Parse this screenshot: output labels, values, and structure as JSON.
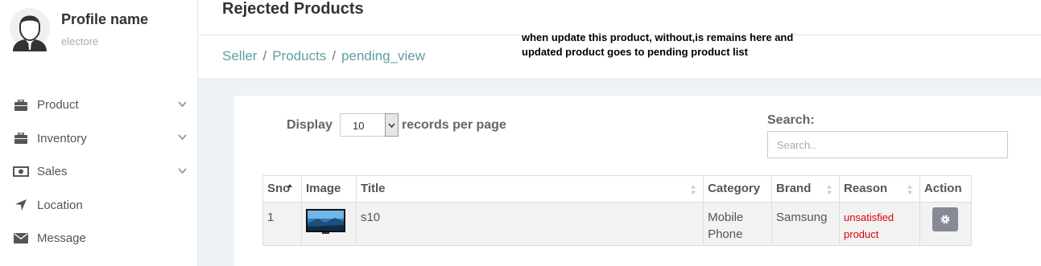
{
  "profile": {
    "name": "Profile name",
    "subtitle": "electore"
  },
  "sidebar": {
    "items": [
      {
        "label": "Product",
        "icon": "briefcase-icon",
        "has_chevron": true
      },
      {
        "label": "Inventory",
        "icon": "briefcase-icon",
        "has_chevron": true
      },
      {
        "label": "Sales",
        "icon": "money-icon",
        "has_chevron": true
      },
      {
        "label": "Location",
        "icon": "location-arrow-icon",
        "has_chevron": false
      },
      {
        "label": "Message",
        "icon": "envelope-icon",
        "has_chevron": false
      }
    ]
  },
  "header": {
    "title": "Rejected Products",
    "breadcrumb": [
      "Seller",
      "Products",
      "pending_view"
    ],
    "separator": "/"
  },
  "annotation": {
    "line1": "when update this product, without,is remains here and",
    "line2": "updated product goes to pending product list"
  },
  "controls": {
    "display_label": "Display",
    "page_size": "10",
    "records_label": "records per page",
    "search_label": "Search:",
    "search_placeholder": "Search.."
  },
  "table": {
    "columns": [
      "Sno",
      "Image",
      "Title",
      "Category",
      "Brand",
      "Reason",
      "Action"
    ],
    "rows": [
      {
        "sno": "1",
        "title": "s10",
        "category": "Mobile Phone",
        "brand": "Samsung",
        "reason": "unsatisfied product"
      }
    ]
  },
  "colors": {
    "breadcrumb": "#5f9ea0",
    "reason": "#d9000d",
    "action_button": "#858a94"
  }
}
